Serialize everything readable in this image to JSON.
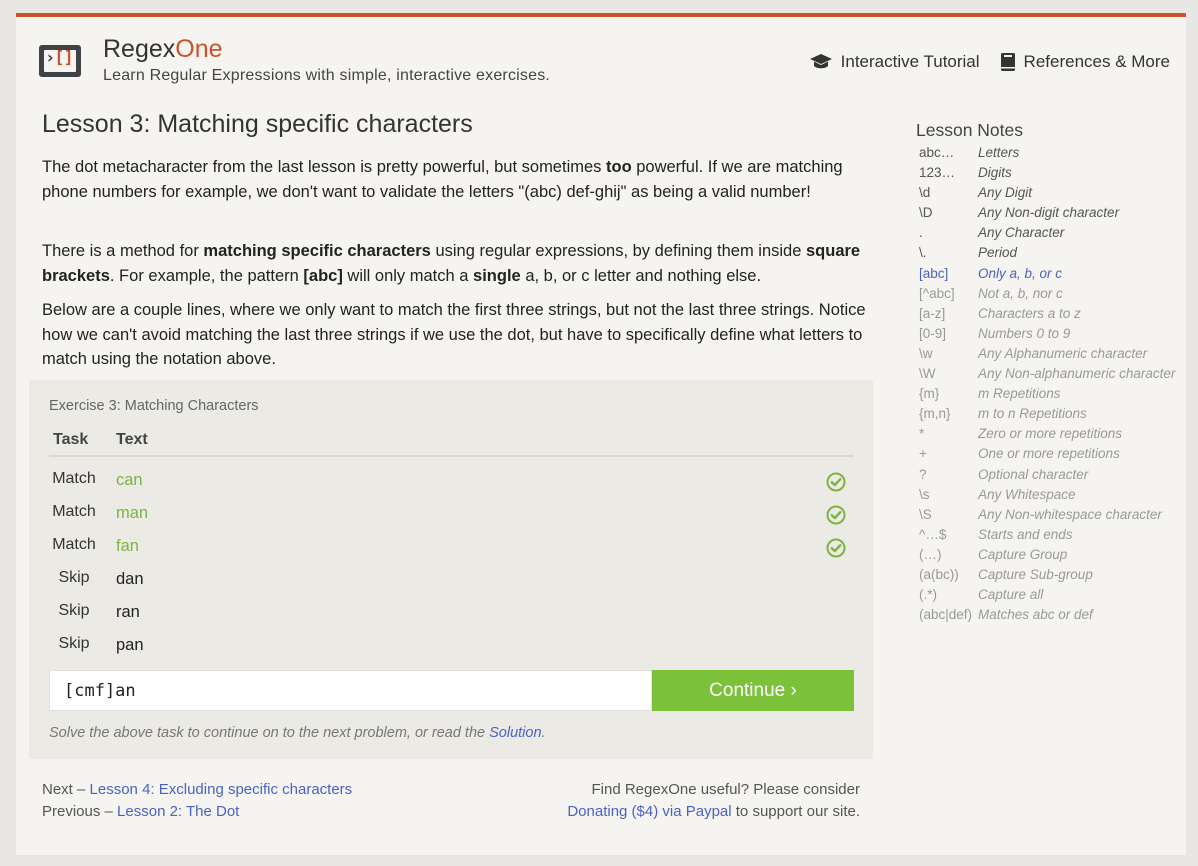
{
  "header": {
    "brand_main": "Regex",
    "brand_accent": "One",
    "tagline": "Learn Regular Expressions with simple, interactive exercises.",
    "nav": [
      {
        "label": "Interactive Tutorial",
        "icon": "graduation-cap-icon"
      },
      {
        "label": "References & More",
        "icon": "book-icon"
      }
    ]
  },
  "lesson": {
    "title": "Lesson 3: Matching specific characters",
    "p1": {
      "a": "The dot metacharacter from the last lesson is pretty powerful, but sometimes ",
      "b": "too",
      "c": " powerful. If we are matching phone numbers for example, we don't want to validate the letters \"(abc) def-ghij\" as being a valid number!"
    },
    "p2": {
      "a": "There is a method for ",
      "b": "matching specific characters",
      "c": " using regular expressions, by defining them inside ",
      "d": "square brackets",
      "e": ". For example, the pattern ",
      "f": "[abc]",
      "g": " will only match a ",
      "h": "single",
      "i": " a, b, or c letter and nothing else."
    },
    "p3": "Below are a couple lines, where we only want to match the first three strings, but not the last three strings. Notice how we can't avoid matching the last three strings if we use the dot, but have to specifically define what letters to match using the notation above."
  },
  "exercise": {
    "title": "Exercise 3: Matching Characters",
    "headers": {
      "task": "Task",
      "text": "Text"
    },
    "rows": [
      {
        "task": "Match",
        "text": "can",
        "matched": true
      },
      {
        "task": "Match",
        "text": "man",
        "matched": true
      },
      {
        "task": "Match",
        "text": "fan",
        "matched": true
      },
      {
        "task": "Skip",
        "text": "dan",
        "matched": false
      },
      {
        "task": "Skip",
        "text": "ran",
        "matched": false
      },
      {
        "task": "Skip",
        "text": "pan",
        "matched": false
      }
    ],
    "input_value": "[cmf]an",
    "continue_label": "Continue ›",
    "hint_prefix": "Solve the above task to continue on to the next problem, or read the ",
    "hint_link": "Solution",
    "hint_suffix": "."
  },
  "footer": {
    "next_prefix": "Next – ",
    "next_link": "Lesson 4: Excluding specific characters",
    "prev_prefix": "Previous – ",
    "prev_link": "Lesson 2: The Dot",
    "donate_line": "Find RegexOne useful? Please consider",
    "donate_link": "Donating ($4) via Paypal",
    "donate_suffix": " to support our site."
  },
  "notes": {
    "title": "Lesson Notes",
    "items": [
      {
        "k": "abc…",
        "v": "Letters",
        "state": "done"
      },
      {
        "k": "123…",
        "v": "Digits",
        "state": "done"
      },
      {
        "k": "\\d",
        "v": "Any Digit",
        "state": "done"
      },
      {
        "k": "\\D",
        "v": "Any Non-digit character",
        "state": "done"
      },
      {
        "k": ".",
        "v": "Any Character",
        "state": "done"
      },
      {
        "k": "\\.",
        "v": "Period",
        "state": "done"
      },
      {
        "k": "[abc]",
        "v": "Only a, b, or c",
        "state": "current"
      },
      {
        "k": "[^abc]",
        "v": "Not a, b, nor c",
        "state": "todo"
      },
      {
        "k": "[a-z]",
        "v": "Characters a to z",
        "state": "todo"
      },
      {
        "k": "[0-9]",
        "v": "Numbers 0 to 9",
        "state": "todo"
      },
      {
        "k": "\\w",
        "v": "Any Alphanumeric character",
        "state": "todo"
      },
      {
        "k": "\\W",
        "v": "Any Non-alphanumeric character",
        "state": "todo"
      },
      {
        "k": "{m}",
        "v": "m Repetitions",
        "state": "todo"
      },
      {
        "k": "{m,n}",
        "v": "m to n Repetitions",
        "state": "todo"
      },
      {
        "k": "*",
        "v": "Zero or more repetitions",
        "state": "todo"
      },
      {
        "k": "+",
        "v": "One or more repetitions",
        "state": "todo"
      },
      {
        "k": "?",
        "v": "Optional character",
        "state": "todo"
      },
      {
        "k": "\\s",
        "v": "Any Whitespace",
        "state": "todo"
      },
      {
        "k": "\\S",
        "v": "Any Non-whitespace character",
        "state": "todo"
      },
      {
        "k": "^…$",
        "v": "Starts and ends",
        "state": "todo"
      },
      {
        "k": "(…)",
        "v": "Capture Group",
        "state": "todo"
      },
      {
        "k": "(a(bc))",
        "v": "Capture Sub-group",
        "state": "todo"
      },
      {
        "k": "(.*)",
        "v": "Capture all",
        "state": "todo"
      },
      {
        "k": "(abc|def)",
        "v": "Matches abc or def",
        "state": "todo"
      }
    ]
  },
  "colors": {
    "accent": "#c9532b",
    "success": "#7cc13a",
    "link": "#4a63c0"
  }
}
